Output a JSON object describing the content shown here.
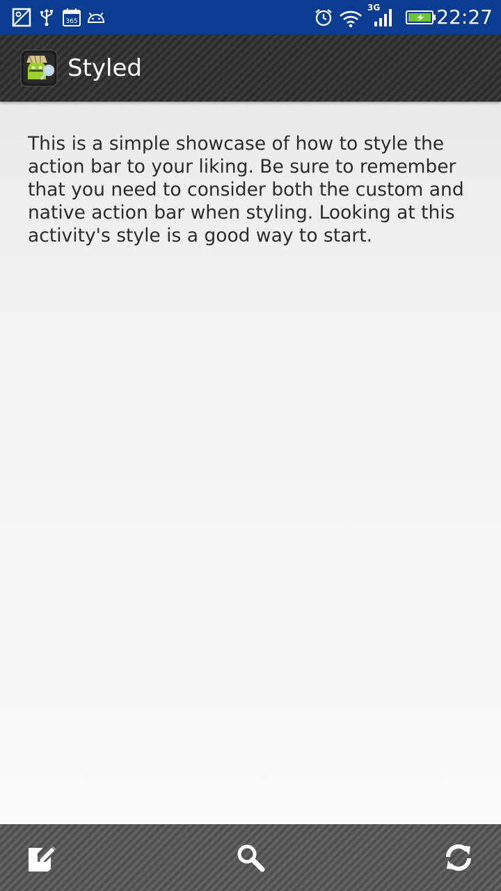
{
  "status_bar": {
    "icons_left": [
      "gallery-icon",
      "usb-icon",
      "calendar-365-icon",
      "android-icon"
    ],
    "calendar_label": "365",
    "icons_right": [
      "alarm-icon",
      "wifi-icon",
      "signal-icon",
      "battery-charging-icon"
    ],
    "network_type": "3G",
    "time": "22:27",
    "color": "#0a3d8f"
  },
  "action_bar": {
    "app_icon": "app-icon",
    "title": "Styled"
  },
  "content": {
    "body_text": "This is a simple showcase of how to style the action bar to your liking. Be sure to remember that you need to consider both the custom and native action bar when styling. Looking at this activity's style is a good way to start."
  },
  "bottom_bar": {
    "actions": [
      {
        "icon": "edit-icon"
      },
      {
        "icon": "search-icon"
      },
      {
        "icon": "refresh-icon"
      }
    ]
  }
}
